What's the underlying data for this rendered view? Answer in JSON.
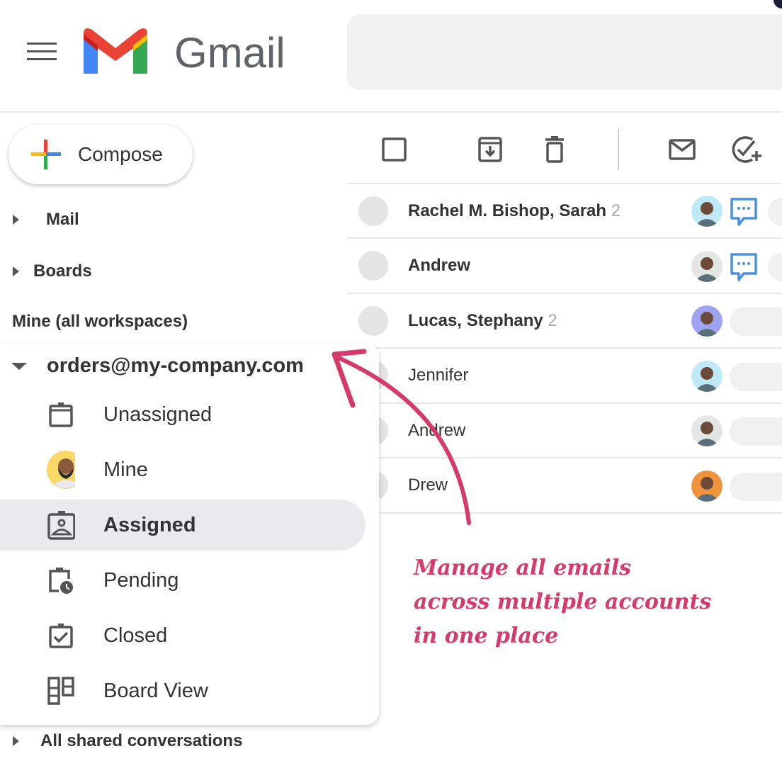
{
  "header": {
    "brand": "Gmail",
    "search_placeholder": ""
  },
  "compose": {
    "label": "Compose"
  },
  "nav": {
    "mail": "Mail",
    "boards": "Boards",
    "section": "Mine (all workspaces)",
    "account": "orders@my-company.com",
    "shared": "All shared conversations"
  },
  "folders": [
    {
      "label": "Unassigned",
      "icon": "clipboard-icon"
    },
    {
      "label": "Mine",
      "icon": "avatar"
    },
    {
      "label": "Assigned",
      "icon": "assigned-badge-icon",
      "selected": true
    },
    {
      "label": "Pending",
      "icon": "clipboard-clock-icon"
    },
    {
      "label": "Closed",
      "icon": "clipboard-check-icon"
    },
    {
      "label": "Board View",
      "icon": "board-icon"
    }
  ],
  "emails": [
    {
      "sender": "Rachel M. Bishop, Sarah",
      "count": "2",
      "unread": true,
      "chat": true
    },
    {
      "sender": "Andrew",
      "count": "",
      "unread": true,
      "chat": true
    },
    {
      "sender": "Lucas, Stephany",
      "count": "2",
      "unread": true,
      "chat": false
    },
    {
      "sender": "Jennifer",
      "count": "",
      "unread": false,
      "chat": false
    },
    {
      "sender": "Andrew",
      "count": "",
      "unread": false,
      "chat": false
    },
    {
      "sender": "Drew",
      "count": "",
      "unread": false,
      "chat": false
    }
  ],
  "annotation": {
    "line1": "Manage all emails",
    "line2": "across multiple accounts",
    "line3": "in one place"
  },
  "colors": {
    "accent": "#d63a6b",
    "chat": "#4a90e2",
    "selected": "#e9eaee"
  }
}
